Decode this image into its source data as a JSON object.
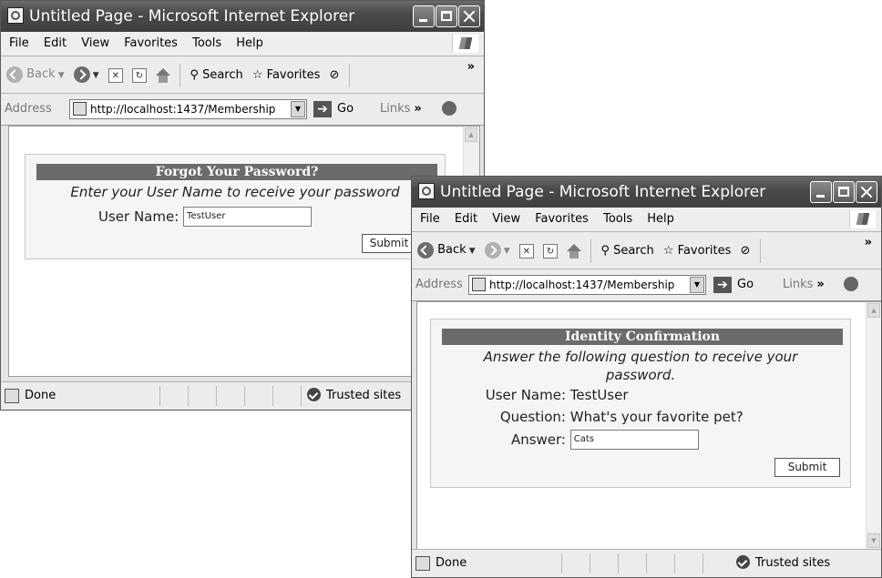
{
  "back_window": {
    "title": "Untitled Page - Microsoft Internet Explorer",
    "menu": [
      "File",
      "Edit",
      "View",
      "Favorites",
      "Tools",
      "Help"
    ],
    "toolbar": {
      "back": "Back",
      "search": "Search",
      "favorites": "Favorites"
    },
    "address": {
      "label": "Address",
      "url": "http://localhost:1437/Membership",
      "go": "Go",
      "links": "Links"
    },
    "page": {
      "header": "Forgot Your Password?",
      "instruction": "Enter your User Name to receive your password",
      "user_name_label": "User Name:",
      "user_name_value": "TestUser",
      "submit": "Submit"
    },
    "status": {
      "text": "Done",
      "zone": "Trusted sites"
    }
  },
  "front_window": {
    "title": "Untitled Page - Microsoft Internet Explorer",
    "menu": [
      "File",
      "Edit",
      "View",
      "Favorites",
      "Tools",
      "Help"
    ],
    "toolbar": {
      "back": "Back",
      "search": "Search",
      "favorites": "Favorites"
    },
    "address": {
      "label": "Address",
      "url": "http://localhost:1437/Membership",
      "go": "Go",
      "links": "Links"
    },
    "page": {
      "header": "Identity Confirmation",
      "instruction_line1": "Answer the following question to receive your",
      "instruction_line2": "password.",
      "user_name_label": "User Name:",
      "user_name_value": "TestUser",
      "question_label": "Question:",
      "question_value": "What's your favorite pet?",
      "answer_label": "Answer:",
      "answer_value": "Cats",
      "submit": "Submit"
    },
    "status": {
      "text": "Done",
      "zone": "Trusted sites"
    }
  }
}
